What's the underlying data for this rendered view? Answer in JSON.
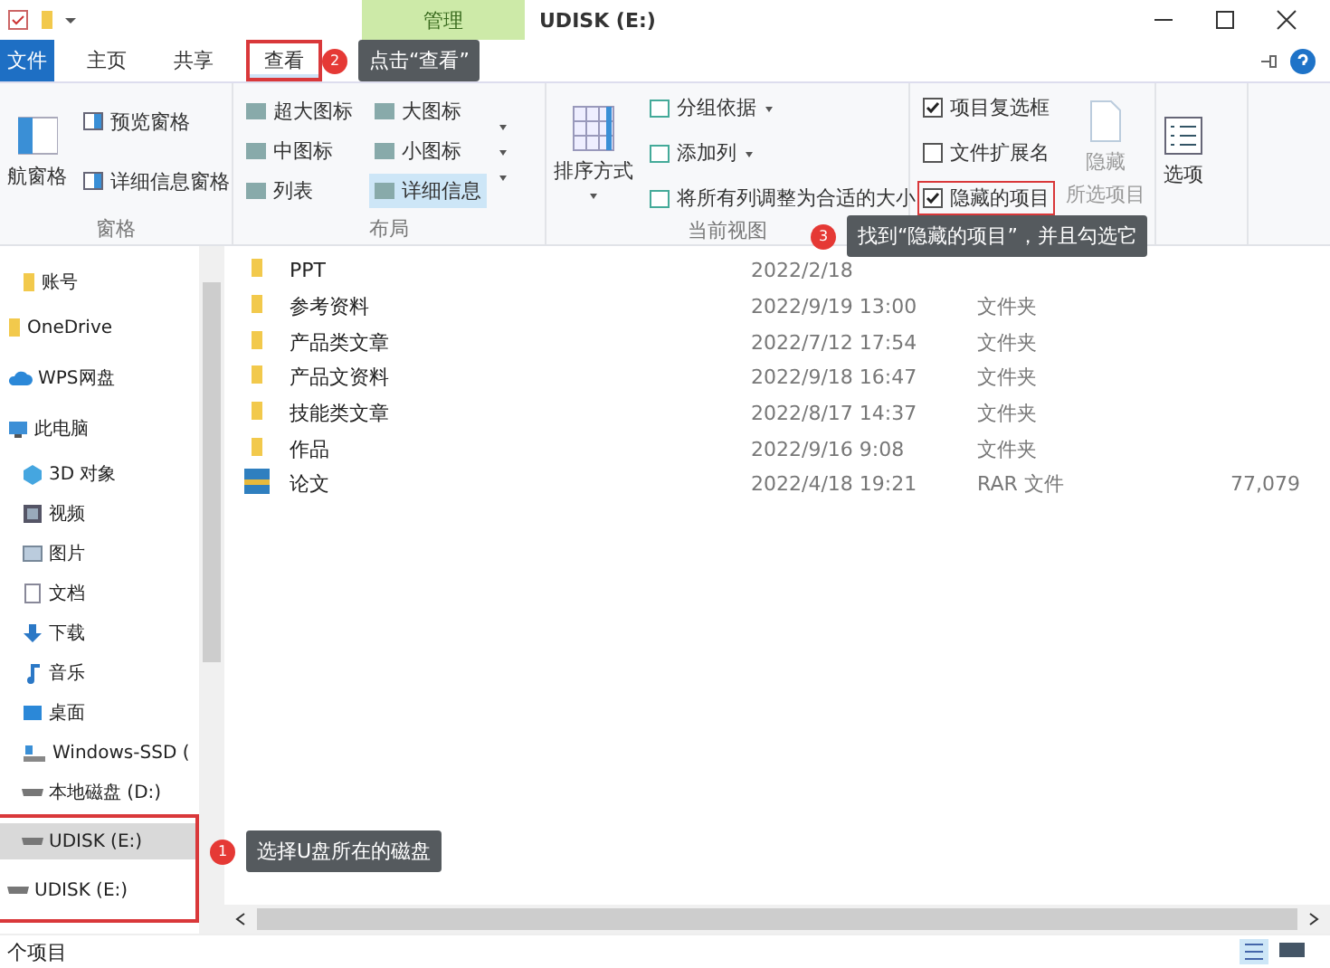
{
  "title_bar": {
    "context_tab": "管理",
    "title": "UDISK (E:)"
  },
  "ribbon_tabs": [
    {
      "label": "文件",
      "kind": "file",
      "selected": false,
      "highlighted": false
    },
    {
      "label": "主页",
      "kind": "tab",
      "selected": false,
      "highlighted": false
    },
    {
      "label": "共享",
      "kind": "tab",
      "selected": false,
      "highlighted": false
    },
    {
      "label": "查看",
      "kind": "tab",
      "selected": true,
      "highlighted": true
    }
  ],
  "ribbon": {
    "panes": {
      "label": "窗格",
      "nav_pane": "航窗格",
      "buttons": [
        "预览窗格",
        "详细信息窗格"
      ]
    },
    "layout": {
      "label": "布局",
      "options": [
        {
          "label": "超大图标",
          "selected": false
        },
        {
          "label": "大图标",
          "selected": false
        },
        {
          "label": "中图标",
          "selected": false
        },
        {
          "label": "小图标",
          "selected": false
        },
        {
          "label": "列表",
          "selected": false
        },
        {
          "label": "详细信息",
          "selected": true
        }
      ]
    },
    "current_view": {
      "label": "当前视图",
      "sort": "排序方式",
      "commands": [
        {
          "label": "分组依据",
          "dropdown": true
        },
        {
          "label": "添加列",
          "dropdown": true
        },
        {
          "label": "将所有列调整为合适的大小",
          "dropdown": false
        }
      ]
    },
    "show_hide": {
      "checkboxes": [
        {
          "label": "项目复选框",
          "checked": true,
          "highlighted": false
        },
        {
          "label": "文件扩展名",
          "checked": false,
          "highlighted": false
        },
        {
          "label": "隐藏的项目",
          "checked": true,
          "highlighted": true
        }
      ],
      "hide_selected": [
        "隐藏",
        "所选项目"
      ]
    },
    "options": {
      "label": "选项"
    }
  },
  "sidebar": {
    "items": [
      {
        "label": "账号",
        "kind": "folder",
        "selected": false
      },
      {
        "label": "OneDrive",
        "kind": "onedrive",
        "selected": false
      },
      {
        "label": "WPS网盘",
        "kind": "cloud",
        "selected": false
      },
      {
        "label": "此电脑",
        "kind": "pc",
        "selected": false
      },
      {
        "label": "3D 对象",
        "kind": "objects",
        "selected": false
      },
      {
        "label": "视频",
        "kind": "video",
        "selected": false
      },
      {
        "label": "图片",
        "kind": "picture",
        "selected": false
      },
      {
        "label": "文档",
        "kind": "document",
        "selected": false
      },
      {
        "label": "下载",
        "kind": "download",
        "selected": false
      },
      {
        "label": "音乐",
        "kind": "music",
        "selected": false
      },
      {
        "label": "桌面",
        "kind": "desktop",
        "selected": false
      },
      {
        "label": "Windows-SSD (",
        "kind": "system-drive",
        "selected": false
      },
      {
        "label": "本地磁盘 (D:)",
        "kind": "drive",
        "selected": false
      }
    ],
    "highlighted_items": [
      {
        "label": "UDISK (E:)",
        "kind": "drive",
        "selected": true
      },
      {
        "label": "UDISK (E:)",
        "kind": "root-drive",
        "selected": false
      }
    ]
  },
  "files": [
    {
      "name": "PPT",
      "kind": "folder",
      "date": "2022/2/18"
    },
    {
      "name": "参考资料",
      "kind": "folder",
      "date": "2022/9/19 13:00",
      "type": "文件夹"
    },
    {
      "name": "产品类文章",
      "kind": "folder",
      "date": "2022/7/12 17:54",
      "type": "文件夹"
    },
    {
      "name": "产品文资料",
      "kind": "folder",
      "date": "2022/9/18 16:47",
      "type": "文件夹"
    },
    {
      "name": "技能类文章",
      "kind": "folder",
      "date": "2022/8/17 14:37",
      "type": "文件夹"
    },
    {
      "name": "作品",
      "kind": "folder",
      "date": "2022/9/16 9:08",
      "type": "文件夹"
    },
    {
      "name": "论文",
      "kind": "archive",
      "date": "2022/4/18 19:21",
      "type": "RAR 文件",
      "size": "77,079"
    }
  ],
  "annotations": [
    {
      "number": "2",
      "text": "点击“查看”"
    },
    {
      "number": "3",
      "text": "找到“隐藏的项目”，并且勾选它"
    },
    {
      "number": "1",
      "text": "选择U盘所在的磁盘"
    }
  ],
  "status_bar": {
    "count": "个项目"
  }
}
